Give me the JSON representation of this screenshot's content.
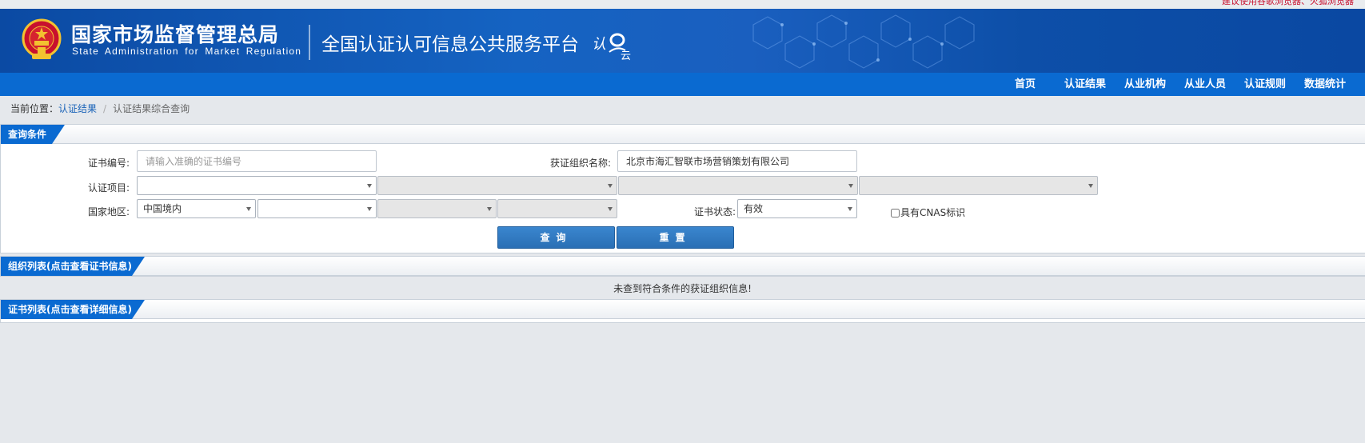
{
  "browser_tip": "建议使用谷歌浏览器、火狐浏览器",
  "header": {
    "site_title": "国家市场监督管理总局",
    "site_title_en": "State Administration for Market Regulation",
    "platform_title": "全国认证认可信息公共服务平台",
    "logo_text_a": "认",
    "logo_text_b": "云"
  },
  "nav": {
    "items": [
      {
        "label": "首页"
      },
      {
        "label": "认证结果"
      },
      {
        "label": "从业机构"
      },
      {
        "label": "从业人员"
      },
      {
        "label": "认证规则"
      },
      {
        "label": "数据统计"
      }
    ]
  },
  "breadcrumb": {
    "prefix": "当前位置：",
    "link": "认证结果",
    "separator": "/",
    "current": "认证结果综合查询"
  },
  "query_panel": {
    "title": "查询条件",
    "cert_no_label": "证书编号:",
    "cert_no_placeholder": "请输入准确的证书编号",
    "cert_no_value": "",
    "org_name_label": "获证组织名称:",
    "org_name_value": "北京市海汇智联市场营销策划有限公司",
    "project_label": "认证项目:",
    "project_selects": [
      "",
      "",
      "",
      ""
    ],
    "region_label": "国家地区:",
    "region_selects": [
      "中国境内",
      "",
      "",
      ""
    ],
    "status_label": "证书状态:",
    "status_value": "有效",
    "cnas_label": "具有CNAS标识",
    "cnas_checked": false,
    "search_button": "查询",
    "reset_button": "重置"
  },
  "org_panel": {
    "title": "组织列表(点击查看证书信息)",
    "empty_message": "未查到符合条件的获证组织信息!"
  },
  "cert_panel": {
    "title": "证书列表(点击查看详细信息)"
  },
  "colors": {
    "banner_blue": "#1563c2",
    "nav_blue": "#0a6ad1",
    "button_blue": "#2a6fb5",
    "tip_red": "#c8102e"
  }
}
